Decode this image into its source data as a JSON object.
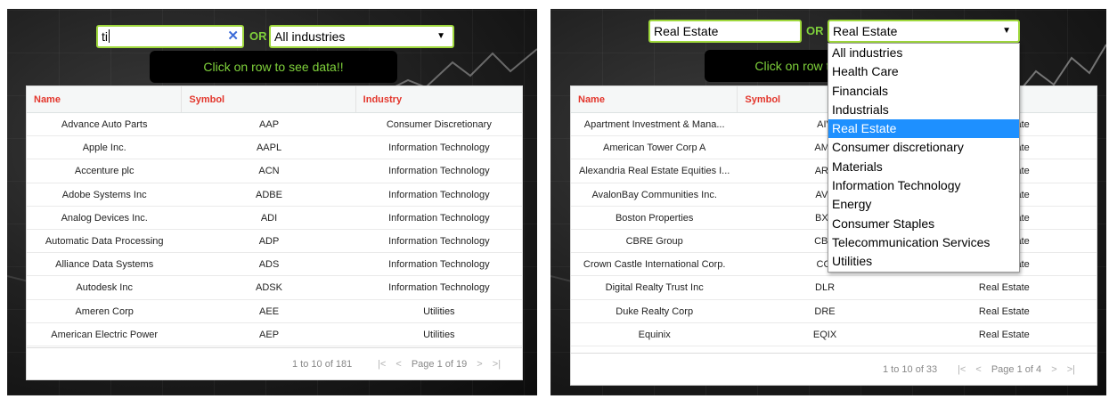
{
  "left": {
    "search": {
      "value": "ti",
      "clear_icon": "✕"
    },
    "or_label": "OR",
    "industry_select": {
      "selected": "All industries",
      "arrow": "▼"
    },
    "hint": "Click on row to see data!!",
    "columns": [
      "Name",
      "Symbol",
      "Industry"
    ],
    "rows": [
      [
        "Advance Auto Parts",
        "AAP",
        "Consumer Discretionary"
      ],
      [
        "Apple Inc.",
        "AAPL",
        "Information Technology"
      ],
      [
        "Accenture plc",
        "ACN",
        "Information Technology"
      ],
      [
        "Adobe Systems Inc",
        "ADBE",
        "Information Technology"
      ],
      [
        "Analog Devices Inc.",
        "ADI",
        "Information Technology"
      ],
      [
        "Automatic Data Processing",
        "ADP",
        "Information Technology"
      ],
      [
        "Alliance Data Systems",
        "ADS",
        "Information Technology"
      ],
      [
        "Autodesk Inc",
        "ADSK",
        "Information Technology"
      ],
      [
        "Ameren Corp",
        "AEE",
        "Utilities"
      ],
      [
        "American Electric Power",
        "AEP",
        "Utilities"
      ]
    ],
    "footer": {
      "range": "1 to 10 of 181",
      "first": "|<",
      "prev": "<",
      "page": "Page 1 of 19",
      "next": ">",
      "last": ">|"
    }
  },
  "right": {
    "search": {
      "value": "Real Estate"
    },
    "or_label": "OR",
    "industry_select": {
      "selected": "Real Estate",
      "arrow": "▼"
    },
    "hint": "Click on row to see data!!",
    "columns": [
      "Name",
      "Symbol",
      "Industry"
    ],
    "rows": [
      [
        "Apartment Investment & Mana...",
        "AIV",
        "Real Estate"
      ],
      [
        "American Tower Corp A",
        "AMT",
        "Real Estate"
      ],
      [
        "Alexandria Real Estate Equities I...",
        "ARE",
        "Real Estate"
      ],
      [
        "AvalonBay Communities Inc.",
        "AVB",
        "Real Estate"
      ],
      [
        "Boston Properties",
        "BXP",
        "Real Estate"
      ],
      [
        "CBRE Group",
        "CBG",
        "Real Estate"
      ],
      [
        "Crown Castle International Corp.",
        "CCI",
        "Real Estate"
      ],
      [
        "Digital Realty Trust Inc",
        "DLR",
        "Real Estate"
      ],
      [
        "Duke Realty Corp",
        "DRE",
        "Real Estate"
      ],
      [
        "Equinix",
        "EQIX",
        "Real Estate"
      ]
    ],
    "dropdown_options": [
      "All industries",
      "Health Care",
      "Financials",
      "Industrials",
      "Real Estate",
      "Consumer discretionary",
      "Materials",
      "Information Technology",
      "Energy",
      "Consumer Staples",
      "Telecommunication Services",
      "Utilities"
    ],
    "dropdown_selected_index": 4,
    "footer": {
      "range": "1 to 10 of 33",
      "first": "|<",
      "prev": "<",
      "page": "Page 1 of 4",
      "next": ">",
      "last": ">|"
    }
  }
}
